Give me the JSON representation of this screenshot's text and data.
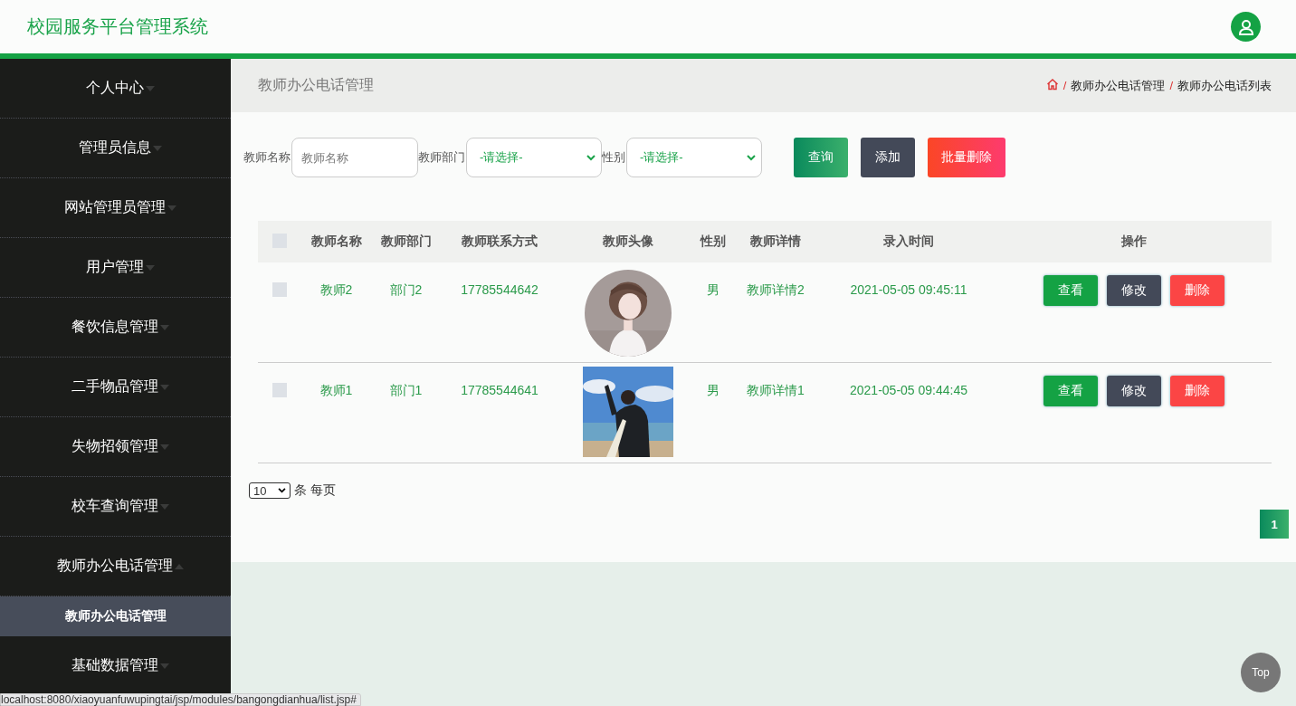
{
  "header": {
    "title": "校园服务平台管理系统"
  },
  "sidebar": {
    "items": [
      {
        "label": "个人中心",
        "expanded": false
      },
      {
        "label": "管理员信息",
        "expanded": false
      },
      {
        "label": "网站管理员管理",
        "expanded": false
      },
      {
        "label": "用户管理",
        "expanded": false
      },
      {
        "label": "餐饮信息管理",
        "expanded": false
      },
      {
        "label": "二手物品管理",
        "expanded": false
      },
      {
        "label": "失物招领管理",
        "expanded": false
      },
      {
        "label": "校车查询管理",
        "expanded": false
      },
      {
        "label": "教师办公电话管理",
        "expanded": true,
        "children": [
          {
            "label": "教师办公电话管理",
            "selected": true
          }
        ]
      },
      {
        "label": "基础数据管理",
        "expanded": false
      }
    ]
  },
  "breadcrumb": {
    "title": "教师办公电话管理",
    "separator": "/",
    "trail": [
      "教师办公电话管理",
      "教师办公电话列表"
    ]
  },
  "search": {
    "fields": [
      {
        "kind": "text",
        "label": "教师名称",
        "placeholder": "教师名称"
      },
      {
        "kind": "select",
        "label": "教师部门",
        "value": "-请选择-"
      },
      {
        "kind": "select",
        "label": "性别",
        "value": "-请选择-"
      }
    ],
    "buttons": [
      {
        "label": "查询",
        "kind": "search"
      },
      {
        "label": "添加",
        "kind": "add"
      },
      {
        "label": "批量删除",
        "kind": "delete"
      }
    ]
  },
  "table": {
    "header_checked": false,
    "columns": [
      "教师名称",
      "教师部门",
      "教师联系方式",
      "教师头像",
      "性别",
      "教师详情",
      "录入时间",
      "操作"
    ],
    "rows": [
      {
        "checked": false,
        "name": "教师2",
        "department": "部门2",
        "phone": "17785544642",
        "avatar": {
          "kind": "round"
        },
        "gender": "男",
        "details": "教师详情2",
        "time": "2021-05-05 09:45:11",
        "actions": [
          {
            "label": "查看",
            "kind": "view"
          },
          {
            "label": "修改",
            "kind": "edit"
          },
          {
            "label": "删除",
            "kind": "delete"
          }
        ]
      },
      {
        "checked": false,
        "name": "教师1",
        "department": "部门1",
        "phone": "17785544641",
        "avatar": {
          "kind": "square"
        },
        "gender": "男",
        "details": "教师详情1",
        "time": "2021-05-05 09:44:45",
        "actions": [
          {
            "label": "查看",
            "kind": "view"
          },
          {
            "label": "修改",
            "kind": "edit"
          },
          {
            "label": "删除",
            "kind": "delete"
          }
        ]
      }
    ]
  },
  "pagination": {
    "page_size": "10",
    "page_size_label": "条 每页",
    "pages": [
      {
        "label": "1",
        "selected": true
      }
    ]
  },
  "back_to_top": "Top",
  "status_url": "localhost:8080/xiaoyuanfuwupingtai/jsp/modules/bangongdianhua/list.jsp#"
}
